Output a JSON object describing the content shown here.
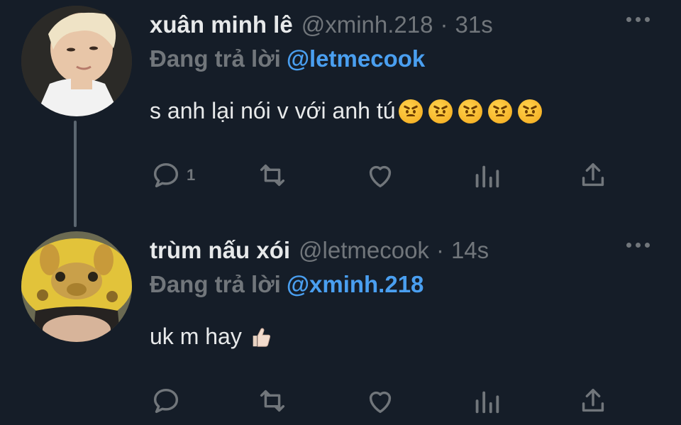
{
  "tweets": [
    {
      "author_name": "xuân minh lê",
      "handle": "@xminh.218",
      "separator": "·",
      "time": "31s",
      "replying_prefix": "Đang trả lời",
      "replying_to": "@letmecook",
      "text": "s anh lại nói v với anh tú",
      "emojis": [
        "angry-face",
        "angry-face",
        "angry-face",
        "angry-face",
        "angry-face"
      ],
      "reply_count": "1"
    },
    {
      "author_name": "trùm nấu xói",
      "handle": "@letmecook",
      "separator": "·",
      "time": "14s",
      "replying_prefix": "Đang trả lời",
      "replying_to": "@xminh.218",
      "text": "uk m hay",
      "emojis": [
        "thumbs-up"
      ],
      "reply_count": ""
    }
  ],
  "colors": {
    "background": "#151d28",
    "text": "#e7e9ea",
    "muted": "#71767b",
    "mention": "#4a9ff0",
    "thread_line": "#5b6670"
  },
  "icons": [
    "reply-icon",
    "retweet-icon",
    "like-icon",
    "analytics-icon",
    "share-icon",
    "more-icon"
  ]
}
